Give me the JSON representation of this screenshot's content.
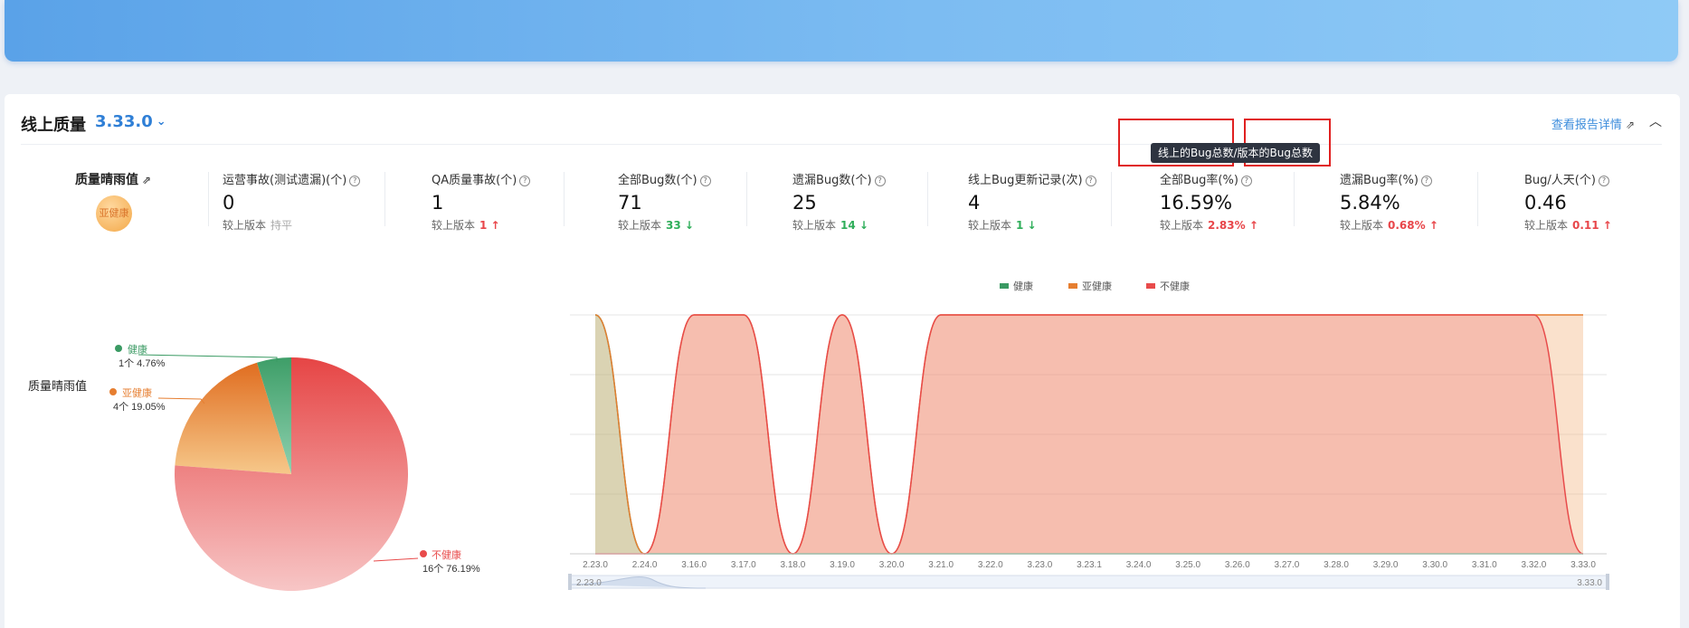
{
  "header": {
    "title": "线上质量",
    "version": "3.33.0",
    "report_link": "查看报告详情",
    "collapse_icon": "chevron-up-icon"
  },
  "quality": {
    "label": "质量晴雨值",
    "status": "亚健康"
  },
  "metrics": [
    {
      "label": "运营事故(测试遗漏)(个)",
      "value": "0",
      "compare_label": "较上版本",
      "delta": "持平",
      "direction": "flat"
    },
    {
      "label": "QA质量事故(个)",
      "value": "1",
      "compare_label": "较上版本",
      "delta": "1",
      "direction": "up"
    },
    {
      "label": "全部Bug数(个)",
      "value": "71",
      "compare_label": "较上版本",
      "delta": "33",
      "direction": "down"
    },
    {
      "label": "遗漏Bug数(个)",
      "value": "25",
      "compare_label": "较上版本",
      "delta": "14",
      "direction": "down"
    },
    {
      "label": "线上Bug更新记录(次)",
      "value": "4",
      "compare_label": "较上版本",
      "delta": "1",
      "direction": "down"
    },
    {
      "label": "全部Bug率(%)",
      "value": "16.59%",
      "compare_label": "较上版本",
      "delta": "2.83%",
      "direction": "up"
    },
    {
      "label": "遗漏Bug率(%)",
      "value": "5.84%",
      "compare_label": "较上版本",
      "delta": "0.68%",
      "direction": "up"
    },
    {
      "label": "Bug/人天(个)",
      "value": "0.46",
      "compare_label": "较上版本",
      "delta": "0.11",
      "direction": "up"
    }
  ],
  "tooltip": "线上的Bug总数/版本的Bug总数",
  "section_label": "质量晴雨值",
  "colors": {
    "healthy": "#3a9a63",
    "sub_healthy": "#e67e30",
    "unhealthy": "#e84b4b",
    "accent": "#2f7fd6"
  },
  "chart_data": [
    {
      "type": "pie",
      "slices": [
        {
          "name": "健康",
          "count_label": "1个",
          "percent_label": "4.76%",
          "value": 4.76
        },
        {
          "name": "亚健康",
          "count_label": "4个",
          "percent_label": "19.05%",
          "value": 19.05
        },
        {
          "name": "不健康",
          "count_label": "16个",
          "percent_label": "76.19%",
          "value": 76.19
        }
      ]
    },
    {
      "type": "area",
      "legend": [
        "健康",
        "亚健康",
        "不健康"
      ],
      "legend_position": "top",
      "categories": [
        "2.23.0",
        "2.24.0",
        "3.16.0",
        "3.17.0",
        "3.18.0",
        "3.19.0",
        "3.20.0",
        "3.21.0",
        "3.22.0",
        "3.23.0",
        "3.23.1",
        "3.24.0",
        "3.25.0",
        "3.26.0",
        "3.27.0",
        "3.28.0",
        "3.29.0",
        "3.30.0",
        "3.31.0",
        "3.32.0",
        "3.33.0"
      ],
      "series": [
        {
          "name": "健康",
          "values": [
            1,
            0,
            0,
            0,
            0,
            0,
            0,
            0,
            0,
            0,
            0,
            0,
            0,
            0,
            0,
            0,
            0,
            0,
            0,
            0,
            0
          ]
        },
        {
          "name": "亚健康",
          "values": [
            1,
            0,
            1,
            1,
            0,
            1,
            0,
            1,
            1,
            1,
            1,
            1,
            1,
            1,
            1,
            1,
            1,
            1,
            1,
            1,
            1
          ]
        },
        {
          "name": "不健康",
          "values": [
            0,
            0,
            1,
            1,
            0,
            1,
            0,
            1,
            1,
            1,
            1,
            1,
            1,
            1,
            1,
            1,
            1,
            1,
            1,
            1,
            0
          ]
        }
      ],
      "grid": true,
      "zoom_range": [
        "2.23.0",
        "3.33.0"
      ]
    }
  ]
}
